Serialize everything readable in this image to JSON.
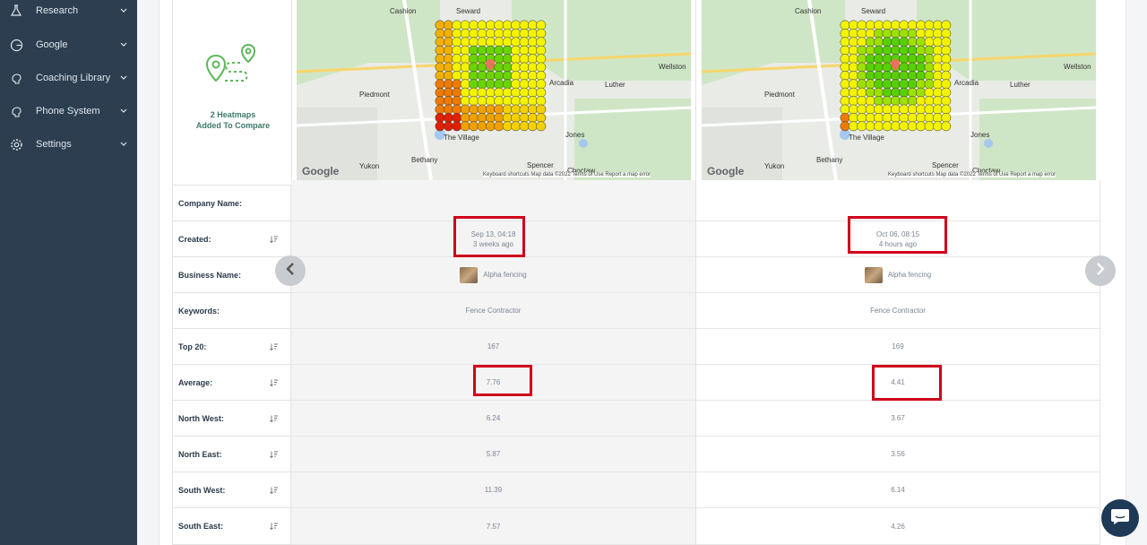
{
  "sidebar": {
    "items": [
      {
        "label": "Research",
        "icon": "flask-icon"
      },
      {
        "label": "Google",
        "icon": "google-icon"
      },
      {
        "label": "Coaching Library",
        "icon": "brain-icon"
      },
      {
        "label": "Phone System",
        "icon": "brain-icon"
      },
      {
        "label": "Settings",
        "icon": "gear-icon"
      }
    ]
  },
  "compare": {
    "line1": "2 Heatmaps",
    "line2": "Added To Compare"
  },
  "map_labels": {
    "cashion": "Cashion",
    "seward": "Seward",
    "wellston": "Wellston",
    "arcadia": "Arcadia",
    "luther": "Luther",
    "piedmont": "Piedmont",
    "the_village": "The Village",
    "jones": "Jones",
    "yukon": "Yukon",
    "bethany": "Bethany",
    "spencer": "Spencer",
    "choctaw": "Choctaw",
    "google": "Google",
    "footer": "Keyboard shortcuts   Map data ©2022   Terms of Use   Report a map error"
  },
  "rows": [
    {
      "label": "Company Name:",
      "sortable": false,
      "a": "",
      "b": ""
    },
    {
      "label": "Created:",
      "sortable": true,
      "a_main": "Sep 13, 04:18",
      "a_sub": "3 weeks ago",
      "b_main": "Oct 06, 08:15",
      "b_sub": "4 hours ago"
    },
    {
      "label": "Business Name:",
      "sortable": false,
      "a": "Alpha fencing",
      "b": "Alpha fencing"
    },
    {
      "label": "Keywords:",
      "sortable": false,
      "a": "Fence Contractor",
      "b": "Fence Contractor"
    },
    {
      "label": "Top 20:",
      "sortable": true,
      "a": "167",
      "b": "169"
    },
    {
      "label": "Average:",
      "sortable": true,
      "a": "7.76",
      "b": "4.41"
    },
    {
      "label": "North West:",
      "sortable": true,
      "a": "6.24",
      "b": "3.67"
    },
    {
      "label": "North East:",
      "sortable": true,
      "a": "5.87",
      "b": "3.56"
    },
    {
      "label": "South West:",
      "sortable": true,
      "a": "11.39",
      "b": "6.14"
    },
    {
      "label": "South East:",
      "sortable": true,
      "a": "7.57",
      "b": "4.26"
    }
  ],
  "colors": {
    "sidebar": "#2c3e50",
    "highlight": "#d0021b",
    "accent_green": "#5cb85c"
  }
}
